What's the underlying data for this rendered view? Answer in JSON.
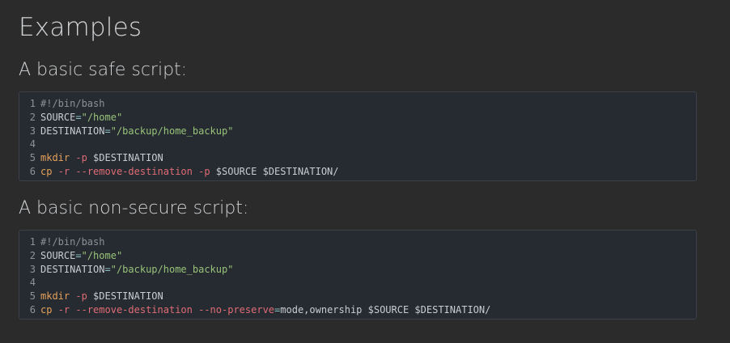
{
  "headings": {
    "title": "Examples",
    "safe": "A basic safe script:",
    "nonsecure": "A basic non-secure script:"
  },
  "colors": {
    "background": "#2b2b2b",
    "code_background": "#262a31",
    "code_border": "#3b4049",
    "comment": "#8b919a",
    "string": "#98c379",
    "operator": "#8fc0c4",
    "command": "#e5a15a",
    "flag": "#e06c75",
    "line_number": "#8d939a"
  },
  "code_blocks": {
    "safe": [
      {
        "n": "1",
        "tokens": [
          {
            "t": "#!/bin/bash",
            "c": "comment"
          }
        ]
      },
      {
        "n": "2",
        "tokens": [
          {
            "t": "SOURCE",
            "c": "plain"
          },
          {
            "t": "=",
            "c": "op"
          },
          {
            "t": "\"/home\"",
            "c": "string"
          }
        ]
      },
      {
        "n": "3",
        "tokens": [
          {
            "t": "DESTINATION",
            "c": "plain"
          },
          {
            "t": "=",
            "c": "op"
          },
          {
            "t": "\"/backup/home_backup\"",
            "c": "string"
          }
        ]
      },
      {
        "n": "4",
        "tokens": []
      },
      {
        "n": "5",
        "tokens": [
          {
            "t": "mkdir",
            "c": "cmd"
          },
          {
            "t": " ",
            "c": "plain"
          },
          {
            "t": "-p",
            "c": "flag"
          },
          {
            "t": " $DESTINATION",
            "c": "plain"
          }
        ]
      },
      {
        "n": "6",
        "tokens": [
          {
            "t": "cp",
            "c": "cmd"
          },
          {
            "t": " ",
            "c": "plain"
          },
          {
            "t": "-r",
            "c": "flag"
          },
          {
            "t": " ",
            "c": "plain"
          },
          {
            "t": "--remove-destination",
            "c": "flag"
          },
          {
            "t": " ",
            "c": "plain"
          },
          {
            "t": "-p",
            "c": "flag"
          },
          {
            "t": " $SOURCE $DESTINATION/",
            "c": "plain"
          }
        ]
      }
    ],
    "nonsecure": [
      {
        "n": "1",
        "tokens": [
          {
            "t": "#!/bin/bash",
            "c": "comment"
          }
        ]
      },
      {
        "n": "2",
        "tokens": [
          {
            "t": "SOURCE",
            "c": "plain"
          },
          {
            "t": "=",
            "c": "op"
          },
          {
            "t": "\"/home\"",
            "c": "string"
          }
        ]
      },
      {
        "n": "3",
        "tokens": [
          {
            "t": "DESTINATION",
            "c": "plain"
          },
          {
            "t": "=",
            "c": "op"
          },
          {
            "t": "\"/backup/home_backup\"",
            "c": "string"
          }
        ]
      },
      {
        "n": "4",
        "tokens": []
      },
      {
        "n": "5",
        "tokens": [
          {
            "t": "mkdir",
            "c": "cmd"
          },
          {
            "t": " ",
            "c": "plain"
          },
          {
            "t": "-p",
            "c": "flag"
          },
          {
            "t": " $DESTINATION",
            "c": "plain"
          }
        ]
      },
      {
        "n": "6",
        "tokens": [
          {
            "t": "cp",
            "c": "cmd"
          },
          {
            "t": " ",
            "c": "plain"
          },
          {
            "t": "-r",
            "c": "flag"
          },
          {
            "t": " ",
            "c": "plain"
          },
          {
            "t": "--remove-destination",
            "c": "flag"
          },
          {
            "t": " ",
            "c": "plain"
          },
          {
            "t": "--no-preserve",
            "c": "flag"
          },
          {
            "t": "=",
            "c": "op"
          },
          {
            "t": "mode,ownership $SOURCE $DESTINATION/",
            "c": "plain"
          }
        ]
      }
    ]
  }
}
